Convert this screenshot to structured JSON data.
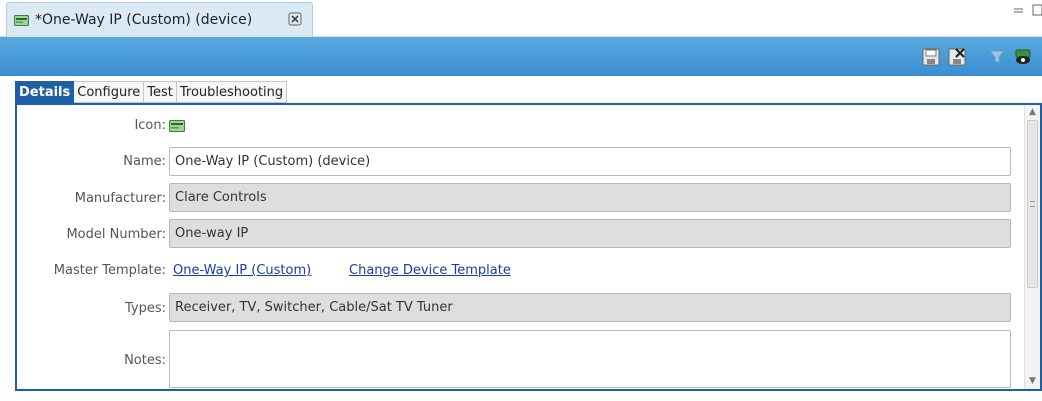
{
  "editor_tab": {
    "title": "*One-Way IP (Custom) (device)",
    "close_icon": "close-icon"
  },
  "toolbar": {
    "buttons": [
      "save-icon",
      "discard-icon",
      "filter-icon",
      "preview-icon"
    ]
  },
  "subtabs": [
    {
      "label": "Details",
      "active": true
    },
    {
      "label": "Configure",
      "active": false
    },
    {
      "label": "Test",
      "active": false
    },
    {
      "label": "Troubleshooting",
      "active": false
    }
  ],
  "details": {
    "icon_label": "Icon:",
    "name_label": "Name:",
    "name_value": "One-Way IP (Custom) (device)",
    "manufacturer_label": "Manufacturer:",
    "manufacturer_value": "Clare Controls",
    "model_label": "Model Number:",
    "model_value": "One-way IP",
    "master_template_label": "Master Template:",
    "master_template_link": "One-Way IP (Custom)",
    "change_template_link": "Change Device Template",
    "types_label": "Types:",
    "types_value": "Receiver, TV, Switcher, Cable/Sat TV Tuner",
    "notes_label": "Notes:",
    "notes_value": ""
  },
  "colors": {
    "toolbar": "#3a8ed2",
    "active_tab": "#1f5fa6",
    "link": "#1a3d9e",
    "readonly_field": "#dedede"
  }
}
